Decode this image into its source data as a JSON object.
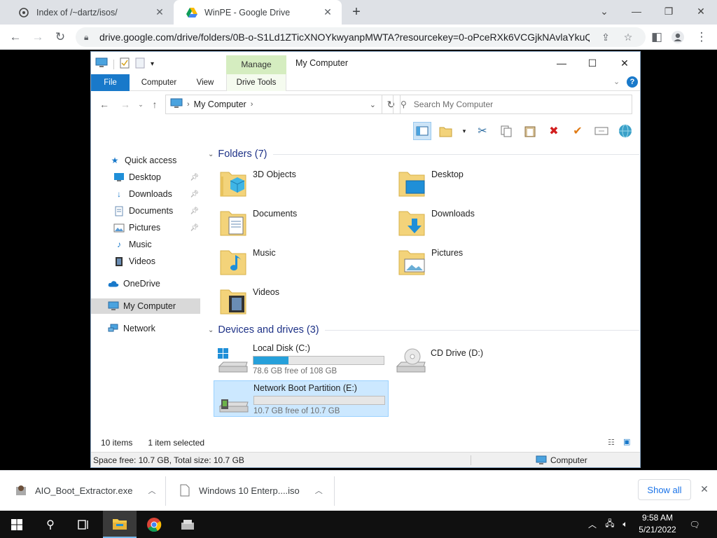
{
  "browser": {
    "tabs": [
      {
        "title": "Index of /~dartz/isos/",
        "icon": "folder-page-icon"
      },
      {
        "title": "WinPE - Google Drive",
        "icon": "google-drive-icon"
      }
    ],
    "url": "drive.google.com/drive/folders/0B-o-S1Ld1ZTicXNOYkwyanpMWTA?resourcekey=0-oPceRXk6VCGjkNAvlaYkuQ"
  },
  "explorer": {
    "window_title": "My Computer",
    "manage_tab": "Manage",
    "ribbon_tabs": [
      "File",
      "Computer",
      "View",
      "Drive Tools"
    ],
    "address_crumb": "My Computer",
    "search_placeholder": "Search My Computer",
    "nav": {
      "quick_access": "Quick access",
      "desktop": "Desktop",
      "downloads": "Downloads",
      "documents": "Documents",
      "pictures": "Pictures",
      "music": "Music",
      "videos": "Videos",
      "onedrive": "OneDrive",
      "my_computer": "My Computer",
      "network": "Network"
    },
    "folders_header": "Folders (7)",
    "folders": [
      "3D Objects",
      "Desktop",
      "Documents",
      "Downloads",
      "Music",
      "Pictures",
      "Videos"
    ],
    "devices_header": "Devices and drives (3)",
    "drives": [
      {
        "name": "Local Disk (C:)",
        "free": "78.6 GB free of 108 GB",
        "used_fraction": 0.27
      },
      {
        "name": "CD Drive (D:)"
      },
      {
        "name": "Network Boot Partition (E:)",
        "free": "10.7 GB free of 10.7 GB",
        "used_fraction": 0.0
      }
    ],
    "status": {
      "items": "10 items",
      "selected": "1 item selected",
      "space": "Space free: 10.7 GB, Total size: 10.7 GB",
      "location": "Computer"
    }
  },
  "downloads": {
    "items": [
      "AIO_Boot_Extractor.exe",
      "Windows 10 Enterp....iso"
    ],
    "show_all": "Show all"
  },
  "taskbar": {
    "time": "9:58 AM",
    "date": "5/21/2022"
  },
  "colors": {
    "accent": "#1979ca",
    "manage": "#d5edc0",
    "selection": "#cce8ff",
    "drive_bar": "#26a0da",
    "folder_header": "#1e3287"
  }
}
